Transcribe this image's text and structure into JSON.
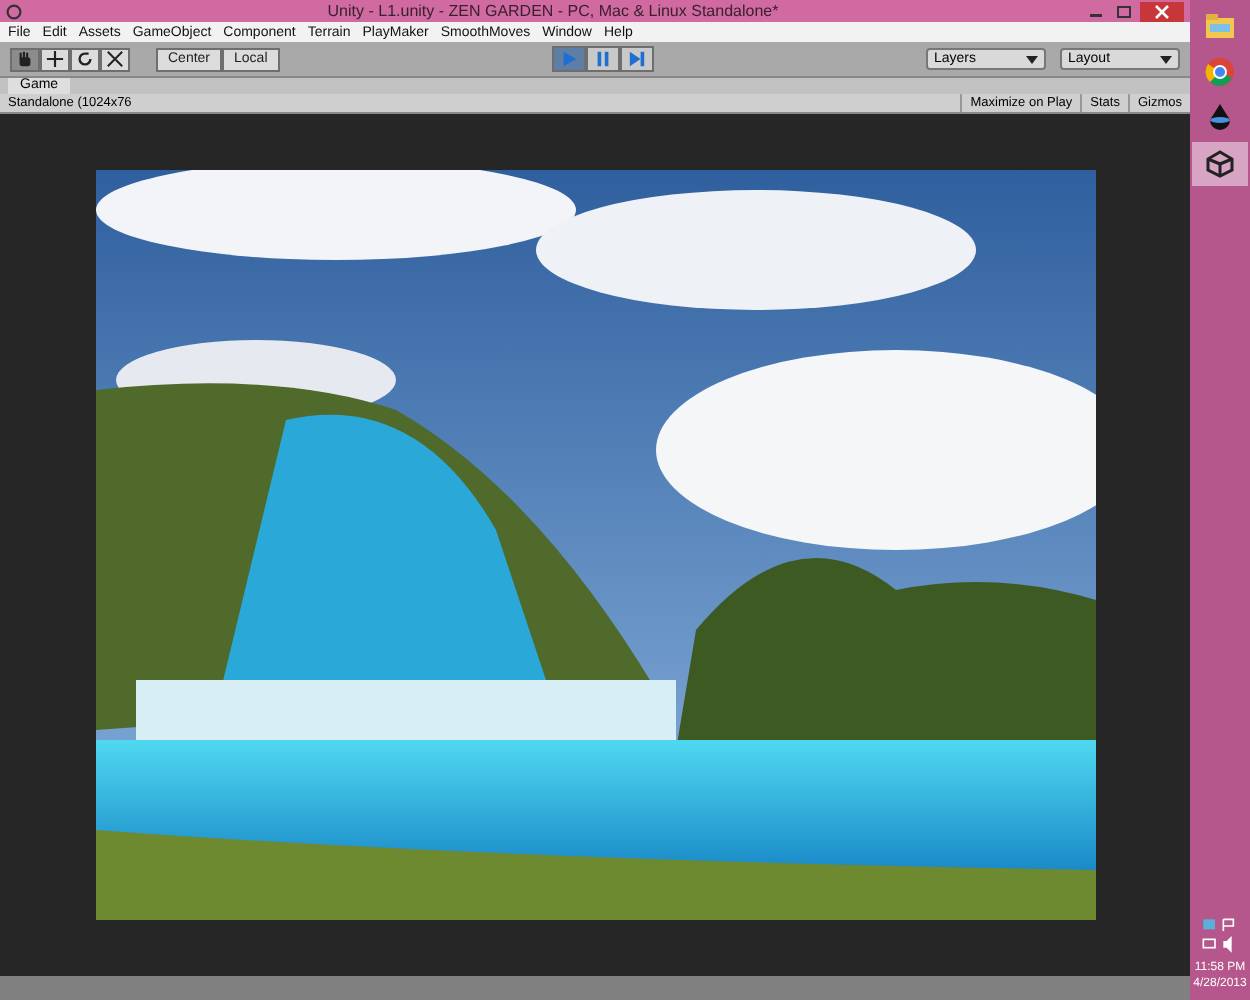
{
  "window": {
    "title": "Unity - L1.unity - ZEN GARDEN - PC, Mac & Linux Standalone*"
  },
  "menu": [
    "File",
    "Edit",
    "Assets",
    "GameObject",
    "Component",
    "Terrain",
    "PlayMaker",
    "SmoothMoves",
    "Window",
    "Help"
  ],
  "tools": [
    {
      "kind": "hand",
      "selected": true
    },
    {
      "kind": "move",
      "selected": false
    },
    {
      "kind": "rotate",
      "selected": false
    },
    {
      "kind": "scale",
      "selected": false
    }
  ],
  "pivot": [
    {
      "label": "Center"
    },
    {
      "label": "Local"
    }
  ],
  "playback": [
    {
      "kind": "play",
      "selected": true
    },
    {
      "kind": "pause",
      "selected": false
    },
    {
      "kind": "step",
      "selected": false
    }
  ],
  "dropdowns": [
    {
      "label": "Layers"
    },
    {
      "label": "Layout"
    }
  ],
  "game_tab": {
    "label": "Game"
  },
  "game_toolbar": {
    "aspect": "Standalone (1024x76",
    "buttons": [
      {
        "label": "Maximize on Play",
        "selected": false
      },
      {
        "label": "Stats",
        "selected": false
      },
      {
        "label": "Gizmos",
        "selected": false
      }
    ]
  },
  "taskbar": {
    "apps": [
      {
        "kind": "folder",
        "selected": false
      },
      {
        "kind": "chrome",
        "selected": false
      },
      {
        "kind": "ink",
        "selected": false
      },
      {
        "kind": "unity",
        "selected": true
      }
    ],
    "time": "11:58 PM",
    "date": "4/28/2013"
  }
}
